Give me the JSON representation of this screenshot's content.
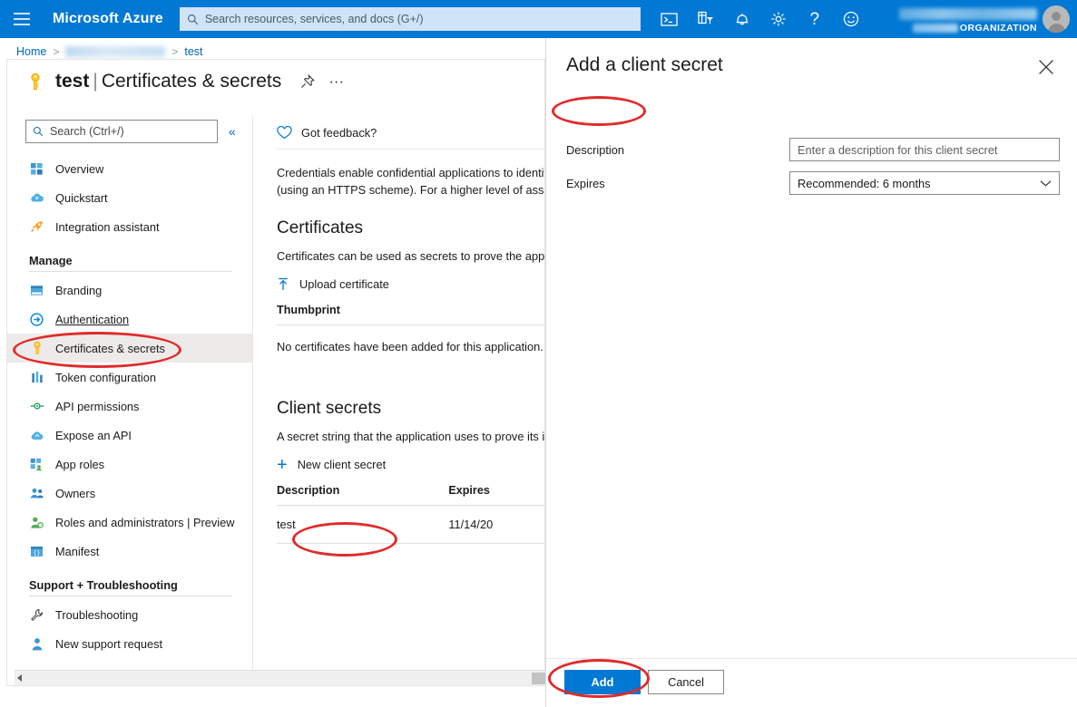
{
  "topbar": {
    "menu_icon": "hamburger-icon",
    "brand": "Microsoft Azure",
    "search_placeholder": "Search resources, services, and docs (G+/)",
    "icons": [
      {
        "name": "cloud-shell-icon",
        "label": "Cloud Shell"
      },
      {
        "name": "directory-filter-icon",
        "label": "Directories + subscriptions"
      },
      {
        "name": "notifications-bell-icon",
        "label": "Notifications"
      },
      {
        "name": "settings-gear-icon",
        "label": "Settings"
      },
      {
        "name": "help-question-icon",
        "label": "Help"
      },
      {
        "name": "feedback-smiley-icon",
        "label": "Feedback"
      }
    ],
    "account_name_redacted": true,
    "organization": "ORGANIZATION"
  },
  "breadcrumb": {
    "home": "Home",
    "redacted": true,
    "current": "test",
    "separator": ">"
  },
  "page": {
    "icon": "key-icon",
    "app_name": "test",
    "divider": "|",
    "section": "Certificates & secrets",
    "pin_icon": "pin-icon",
    "more_icon": "ellipsis-icon"
  },
  "sidebar": {
    "search_placeholder": "Search (Ctrl+/)",
    "search_icon": "search-icon",
    "collapse_icon": "chevron-double-left-icon",
    "items": [
      {
        "label": "Overview",
        "icon": "overview-grid-icon",
        "selected": false
      },
      {
        "label": "Quickstart",
        "icon": "quickstart-cloud-icon",
        "selected": false
      },
      {
        "label": "Integration assistant",
        "icon": "rocket-icon",
        "selected": false
      }
    ],
    "groups": [
      {
        "title": "Manage",
        "items": [
          {
            "label": "Branding",
            "icon": "branding-browser-icon",
            "selected": false,
            "hovered": false
          },
          {
            "label": "Authentication",
            "icon": "authentication-arrow-icon",
            "selected": false,
            "hovered": true
          },
          {
            "label": "Certificates & secrets",
            "icon": "key-icon",
            "selected": true,
            "hovered": false
          },
          {
            "label": "Token configuration",
            "icon": "token-bars-icon",
            "selected": false,
            "hovered": false
          },
          {
            "label": "API permissions",
            "icon": "api-permissions-icon",
            "selected": false,
            "hovered": false
          },
          {
            "label": "Expose an API",
            "icon": "expose-api-cloud-icon",
            "selected": false,
            "hovered": false
          },
          {
            "label": "App roles",
            "icon": "app-roles-icon",
            "selected": false,
            "hovered": false
          },
          {
            "label": "Owners",
            "icon": "owners-people-icon",
            "selected": false,
            "hovered": false
          },
          {
            "label": "Roles and administrators | Preview",
            "icon": "roles-admin-icon",
            "selected": false,
            "hovered": false
          },
          {
            "label": "Manifest",
            "icon": "manifest-icon",
            "selected": false,
            "hovered": false
          }
        ]
      },
      {
        "title": "Support + Troubleshooting",
        "items": [
          {
            "label": "Troubleshooting",
            "icon": "wrench-icon",
            "selected": false,
            "hovered": false
          },
          {
            "label": "New support request",
            "icon": "support-person-icon",
            "selected": false,
            "hovered": false
          }
        ]
      }
    ]
  },
  "content": {
    "feedback": {
      "label": "Got feedback?",
      "icon": "heart-icon"
    },
    "intro_line1": "Credentials enable confidential applications to identif",
    "intro_line2": "(using an HTTPS scheme). For a higher level of assura",
    "certificates": {
      "heading": "Certificates",
      "description": "Certificates can be used as secrets to prove the applic",
      "upload_label": "Upload certificate",
      "upload_icon": "upload-icon",
      "column_header": "Thumbprint",
      "empty_message": "No certificates have been added for this application."
    },
    "client_secrets": {
      "heading": "Client secrets",
      "description": "A secret string that the application uses to prove its i",
      "new_secret_label": "New client secret",
      "new_secret_icon": "plus-icon",
      "columns": [
        "Description",
        "Expires"
      ],
      "rows": [
        {
          "description": "test",
          "expires": "11/14/20"
        }
      ]
    }
  },
  "panel": {
    "title": "Add a client secret",
    "close_icon": "close-icon",
    "fields": [
      {
        "label": "Description",
        "type": "text",
        "value": "",
        "placeholder": "Enter a description for this client secret"
      },
      {
        "label": "Expires",
        "type": "select",
        "value": "Recommended: 6 months",
        "chevron_icon": "chevron-down-icon"
      }
    ],
    "add_button": "Add",
    "cancel_button": "Cancel"
  },
  "annotations": {
    "color": "#e02b2b",
    "targets": [
      "sidebar-item-certificates-secrets",
      "new-client-secret-button",
      "panel-description-label",
      "panel-add-button"
    ]
  },
  "colors": {
    "azure_blue": "#0078d4",
    "link_blue": "#0067b8",
    "selected_bg": "#edebe9",
    "annotation_red": "#e02b2b",
    "key_yellow": "#ffb900"
  }
}
